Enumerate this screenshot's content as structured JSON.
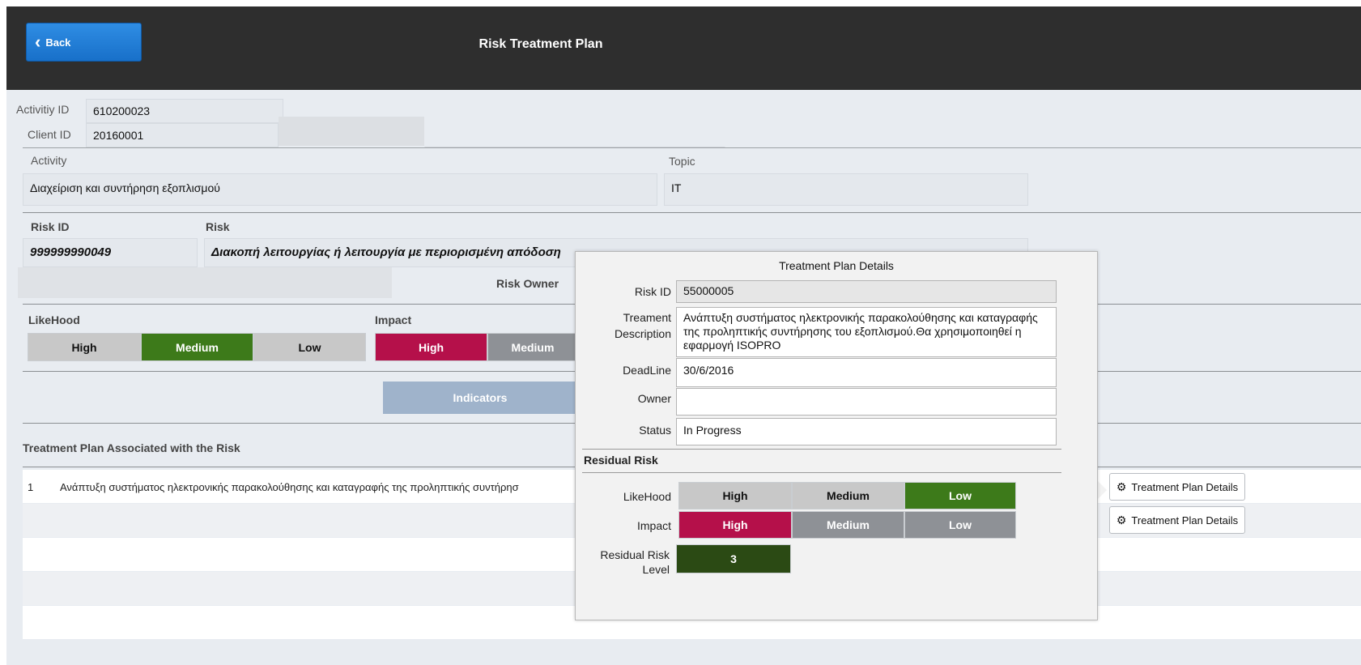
{
  "header": {
    "back_label": "Back",
    "title": "Risk Treatment Plan"
  },
  "ids": {
    "activity_id_label": "Activitiy ID",
    "activity_id": "610200023",
    "client_id_label": "Client ID",
    "client_id": "20160001"
  },
  "activity": {
    "label": "Activity",
    "value": "Διαχείριση και συντήρηση εξοπλισμού",
    "topic_label": "Topic",
    "topic": "IT"
  },
  "risk": {
    "id_label": "Risk ID",
    "id": "999999990049",
    "label": "Risk",
    "text": "Διακοπή λειτουργίας ή λειτουργία με περιορισμένη απόδοση",
    "owner_label": "Risk Owner"
  },
  "likelihood": {
    "label": "LikeHood",
    "options": [
      "High",
      "Medium",
      "Low"
    ],
    "selected": "Medium"
  },
  "impact": {
    "label": "Impact",
    "options": [
      "High",
      "Medium"
    ],
    "selected": "High"
  },
  "indicators_label": "Indicators",
  "treatment_section_title": "Treatment Plan Associated with the Risk",
  "treatment_rows": [
    {
      "num": "1",
      "text": "Ανάπτυξη συστήματος ηλεκτρονικής παρακολούθησης και καταγραφής της προληπτικής συντήρησ"
    }
  ],
  "treatment_button_label": "Treatment Plan Details",
  "popup": {
    "title": "Treatment Plan Details",
    "risk_id_label": "Risk ID",
    "risk_id": "55000005",
    "description_label": "Treament Description",
    "description": "Ανάπτυξη συστήματος ηλεκτρονικής παρακολούθησης και καταγραφής της προληπτικής συντήρησης του εξοπλισμού.Θα χρησιμοποιηθεί η εφαρμογή ISOPRO",
    "deadline_label": "DeadLine",
    "deadline": "30/6/2016",
    "owner_label": "Owner",
    "owner": "",
    "status_label": "Status",
    "status": "In Progress",
    "residual_header": "Residual Risk",
    "residual_likelihood_label": "LikeHood",
    "residual_likelihood_options": [
      "High",
      "Medium",
      "Low"
    ],
    "residual_likelihood_selected": "Low",
    "residual_impact_label": "Impact",
    "residual_impact_options": [
      "High",
      "Medium",
      "Low"
    ],
    "residual_impact_selected": "High",
    "residual_level_label": "Residual Risk Level",
    "residual_level": "3"
  },
  "colors": {
    "header_bg": "#2e2e2e",
    "back_button": "#1f7bd8",
    "selected_green": "#3d7a1a",
    "selected_crimson": "#b5104a",
    "level_green": "#2b4a14",
    "indicators_bg": "#9fb3cb"
  }
}
